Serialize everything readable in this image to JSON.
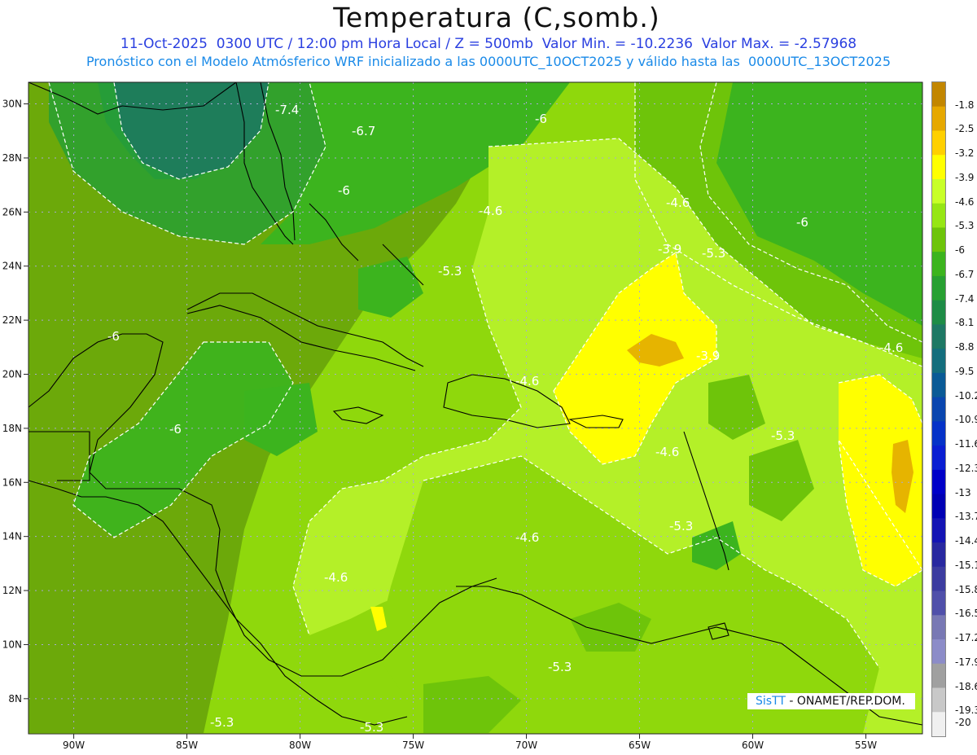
{
  "title": "Temperatura (C,somb.)",
  "subtitle_line1": "11-Oct-2025  0300 UTC / 12:00 pm Hora Local / Z = 500mb  Valor Min. = -10.2236  Valor Max. = -2.57968",
  "subtitle_line2": "Pronóstico con el Modelo Atmósferico WRF inicializado a las 0000UTC_10OCT2025 y válido hasta las  0000UTC_13OCT2025",
  "credit": {
    "logo": "SisTT",
    "text": " - ONAMET/REP.DOM."
  },
  "map": {
    "lon_range": [
      -92,
      -52.5
    ],
    "lat_range": [
      6.7,
      30.8
    ],
    "lon_ticks": [
      "90W",
      "85W",
      "80W",
      "75W",
      "70W",
      "65W",
      "60W",
      "55W"
    ],
    "lat_ticks": [
      "30N",
      "28N",
      "26N",
      "24N",
      "22N",
      "20N",
      "18N",
      "16N",
      "14N",
      "12N",
      "10N",
      "8N"
    ],
    "contour_labels": [
      "-7.4",
      "-6.7",
      "-6",
      "-6",
      "-6",
      "-6",
      "-6",
      "-4.6",
      "-4.6",
      "-4.6",
      "-4.6",
      "-4.6",
      "-3.9",
      "-3.9",
      "-5.3",
      "-5.3",
      "-5.3",
      "-5.3",
      "-5.3",
      "-5.3",
      "-4.6",
      "-5.3",
      "-4.6"
    ]
  },
  "colorbar": {
    "labels": [
      "-1.8",
      "-2.5",
      "-3.2",
      "-3.9",
      "-4.6",
      "-5.3",
      "-6",
      "-6.7",
      "-7.4",
      "-8.1",
      "-8.8",
      "-9.5",
      "-10.2",
      "-10.9",
      "-11.6",
      "-12.3",
      "-13",
      "-13.7",
      "-14.4",
      "-15.1",
      "-15.8",
      "-16.5",
      "-17.2",
      "-17.9",
      "-18.6",
      "-19.3",
      "-20"
    ],
    "colors": [
      "#c28600",
      "#e6a800",
      "#ffd000",
      "#ffff00",
      "#c8ff28",
      "#96e614",
      "#6ec40a",
      "#3cb41e",
      "#28a032",
      "#1e8c46",
      "#1e7864",
      "#146e7d",
      "#0a5a96",
      "#0a46af",
      "#0532c8",
      "#0a1ed2",
      "#0000c8",
      "#0000b4",
      "#1414b4",
      "#2828a0",
      "#3c3ca0",
      "#5050aa",
      "#7878b4",
      "#8c8cc8",
      "#a0a0a0",
      "#c8c8c8",
      "#f0f0f0"
    ]
  }
}
